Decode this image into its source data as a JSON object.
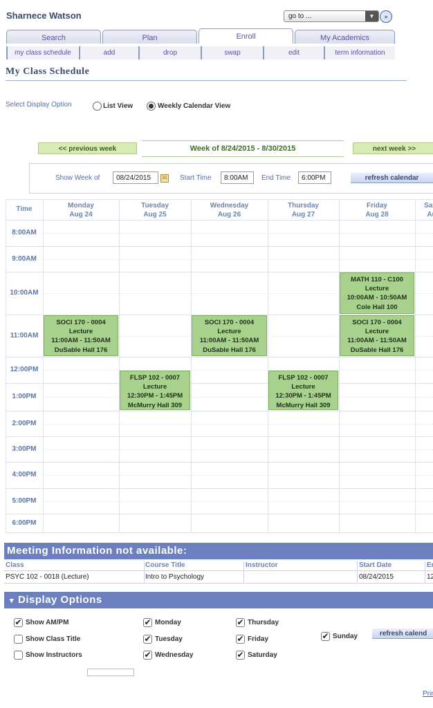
{
  "header": {
    "user_name": "Sharnece Watson",
    "goto_value": "go to ..."
  },
  "tabs": [
    "Search",
    "Plan",
    "Enroll",
    "My Academics"
  ],
  "subtabs": [
    "my class schedule",
    "add",
    "drop",
    "swap",
    "edit",
    "term information"
  ],
  "page_title": "My Class Schedule",
  "display": {
    "label": "Select Display Option",
    "list_view": "List View",
    "weekly_view": "Weekly Calendar View"
  },
  "week_nav": {
    "prev": "<< previous week",
    "label": "Week of 8/24/2015 - 8/30/2015",
    "next": "next week >>"
  },
  "filter": {
    "show_week_label": "Show Week of",
    "show_week_value": "08/24/2015",
    "start_label": "Start Time",
    "start_value": "8:00AM",
    "end_label": "End Time",
    "end_value": "6:00PM",
    "refresh_label": "refresh calendar"
  },
  "calendar": {
    "time_header": "Time",
    "days": [
      {
        "name": "Monday",
        "date": "Aug 24"
      },
      {
        "name": "Tuesday",
        "date": "Aug 25"
      },
      {
        "name": "Wednesday",
        "date": "Aug 26"
      },
      {
        "name": "Thursday",
        "date": "Aug 27"
      },
      {
        "name": "Friday",
        "date": "Aug 28"
      },
      {
        "name": "Satu",
        "date": "Au"
      }
    ],
    "times": [
      "8:00AM",
      "9:00AM",
      "10:00AM",
      "11:00AM",
      "12:00PM",
      "1:00PM",
      "2:00PM",
      "3:00PM",
      "4:00PM",
      "5:00PM",
      "6:00PM"
    ],
    "events": [
      {
        "day": 4,
        "start": 10,
        "end": 11,
        "lines": [
          "MATH 110 - C100",
          "Lecture",
          "10:00AM - 10:50AM",
          "Cole Hall 100"
        ]
      },
      {
        "day": 0,
        "start": 11,
        "end": 12,
        "lines": [
          "SOCI 170 - 0004",
          "Lecture",
          "11:00AM - 11:50AM",
          "DuSable Hall 176"
        ]
      },
      {
        "day": 2,
        "start": 11,
        "end": 12,
        "lines": [
          "SOCI 170 - 0004",
          "Lecture",
          "11:00AM - 11:50AM",
          "DuSable Hall 176"
        ]
      },
      {
        "day": 4,
        "start": 11,
        "end": 12,
        "lines": [
          "SOCI 170 - 0004",
          "Lecture",
          "11:00AM - 11:50AM",
          "DuSable Hall 176"
        ]
      },
      {
        "day": 1,
        "start": 12.5,
        "end": 14,
        "lines": [
          "FLSP 102 - 0007",
          "Lecture",
          "12:30PM - 1:45PM",
          "McMurry Hall 309"
        ]
      },
      {
        "day": 3,
        "start": 12.5,
        "end": 14,
        "lines": [
          "FLSP 102 - 0007",
          "Lecture",
          "12:30PM - 1:45PM",
          "McMurry Hall 309"
        ]
      }
    ]
  },
  "meeting_info": {
    "title": "Meeting Information not available:",
    "columns": [
      "Class",
      "Course Title",
      "Instructor",
      "Start Date",
      "En"
    ],
    "row": [
      "PSYC  102 - 0018 (Lecture)",
      "Intro to Psychology",
      "",
      "08/24/2015",
      "12"
    ]
  },
  "display_options": {
    "title": "Display Options",
    "toggle_glyph": "▾",
    "check_glyph": "✔",
    "items": [
      {
        "label": "Show AM/PM",
        "checked": true
      },
      {
        "label": "Show Class Title",
        "checked": false
      },
      {
        "label": "Show Instructors",
        "checked": false
      },
      {
        "label": "Monday",
        "checked": true
      },
      {
        "label": "Tuesday",
        "checked": true
      },
      {
        "label": "Wednesday",
        "checked": true
      },
      {
        "label": "Thursday",
        "checked": true
      },
      {
        "label": "Friday",
        "checked": true
      },
      {
        "label": "Saturday",
        "checked": true
      },
      {
        "label": "Sunday",
        "checked": true
      }
    ],
    "refresh_label": "refresh calend"
  },
  "print_label": "Prin",
  "colors": {
    "event_bg": "#a9d18e",
    "header_bar": "#6c80c0",
    "link": "#5a4fa0"
  }
}
